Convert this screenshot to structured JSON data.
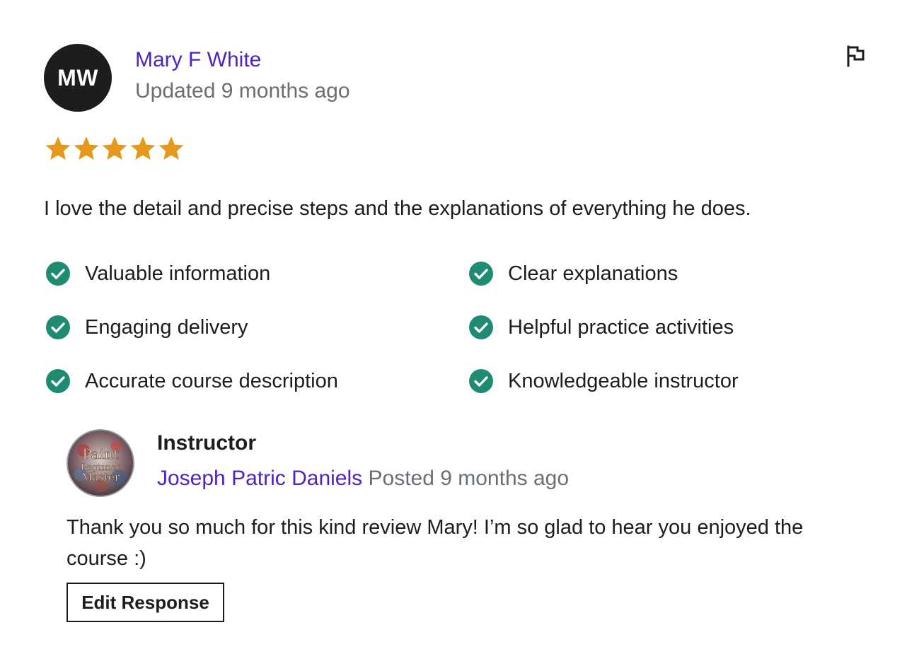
{
  "review": {
    "avatar_initials": "MW",
    "reviewer_name": "Mary F White",
    "date": "Updated 9 months ago",
    "rating": 5,
    "max_rating": 5,
    "text": "I love the detail and precise steps and the explanations of everything he does.",
    "tags": [
      "Valuable information",
      "Clear explanations",
      "Engaging delivery",
      "Helpful practice activities",
      "Accurate course description",
      "Knowledgeable instructor"
    ]
  },
  "response": {
    "role": "Instructor",
    "instructor_name": "Joseph Patric Daniels",
    "posted": "Posted 9 months ago",
    "avatar_logo_text": [
      "Paint",
      "Beginner",
      "Master"
    ],
    "text": "Thank you so much for this kind review Mary! I’m so glad to hear you enjoyed the course :)",
    "edit_label": "Edit Response"
  },
  "colors": {
    "link_purple": "#5022c3",
    "muted_gray": "#6a6f73",
    "star_orange": "#e59819",
    "check_teal": "#1e8b72",
    "text_dark": "#1c1d1f"
  },
  "icons": {
    "flag": "flag-icon",
    "star": "star-icon",
    "check": "check-circle-icon"
  }
}
